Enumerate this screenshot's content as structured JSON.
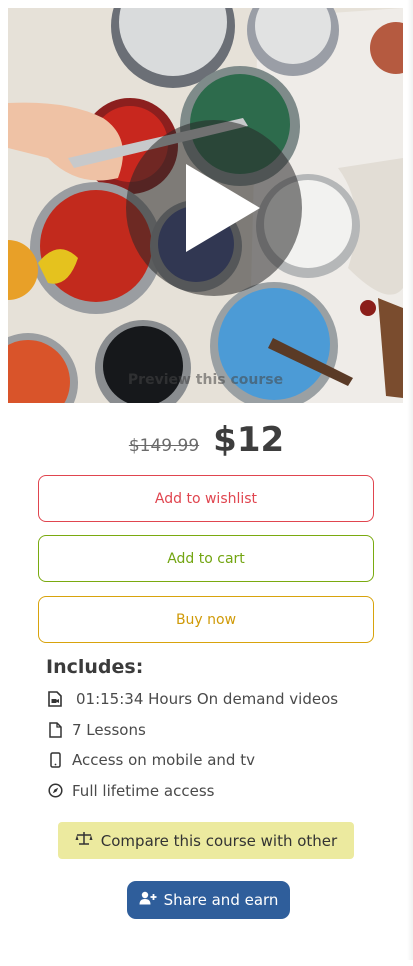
{
  "preview": {
    "label": "Preview this course",
    "play_icon": "play-icon"
  },
  "price": {
    "original": "$149.99",
    "current": "$12"
  },
  "actions": {
    "wishlist_label": "Add to wishlist",
    "cart_label": "Add to cart",
    "buy_label": "Buy now"
  },
  "includes": {
    "title": "Includes:",
    "items": [
      {
        "icon": "video-file-icon",
        "text": "01:15:34 Hours On demand videos"
      },
      {
        "icon": "document-icon",
        "text": "7 Lessons"
      },
      {
        "icon": "mobile-icon",
        "text": "Access on mobile and tv"
      },
      {
        "icon": "compass-icon",
        "text": "Full lifetime access"
      }
    ]
  },
  "compare": {
    "label": "Compare this course with other",
    "icon": "balance-scale-icon"
  },
  "share": {
    "label": "Share and earn",
    "icon": "user-plus-icon"
  },
  "colors": {
    "wishlist": "#e0454f",
    "cart": "#73a512",
    "buy": "#d09a08",
    "compare_bg": "#ecea9f",
    "share_bg": "#2f5e9b"
  }
}
